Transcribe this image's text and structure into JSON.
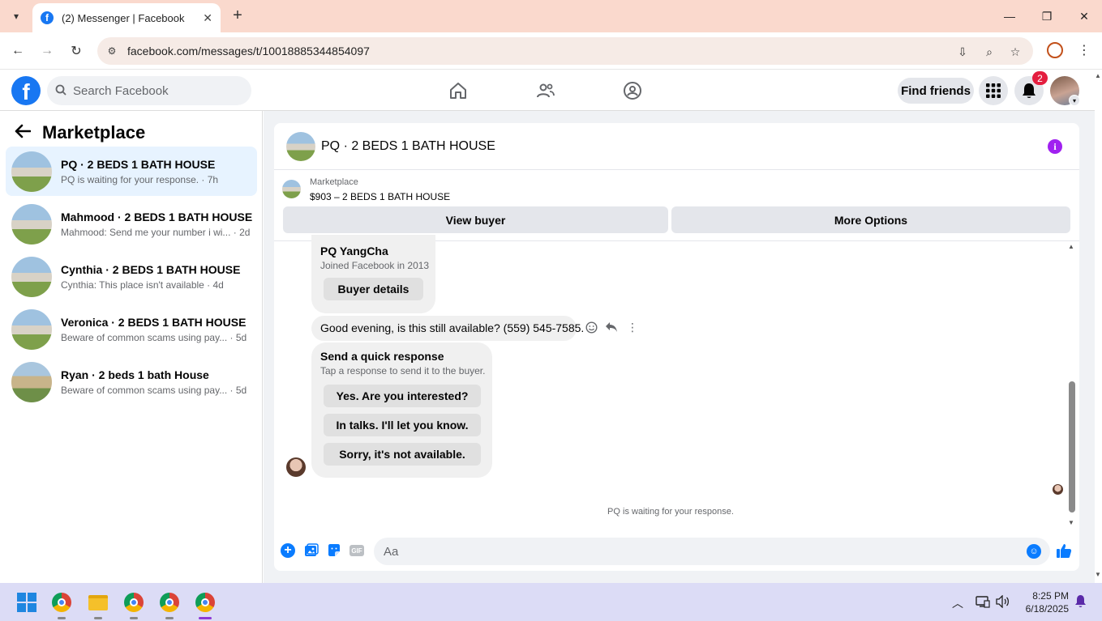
{
  "browser": {
    "tab_title": "(2) Messenger | Facebook",
    "url": "facebook.com/messages/t/10018885344854097"
  },
  "fb_header": {
    "logo": "f",
    "search_placeholder": "Search Facebook",
    "find_friends_label": "Find friends",
    "notification_count": "2"
  },
  "sidebar": {
    "title": "Marketplace",
    "conversations": [
      {
        "name": "PQ · 2 BEDS 1 BATH HOUSE",
        "preview": "PQ is waiting for your response. · 7h"
      },
      {
        "name": "Mahmood · 2 BEDS 1 BATH HOUSE",
        "preview": "Mahmood: Send me your number i wi... · 2d"
      },
      {
        "name": "Cynthia · 2 BEDS 1 BATH HOUSE",
        "preview": "Cynthia: This place isn't available · 4d"
      },
      {
        "name": "Veronica · 2 BEDS 1 BATH HOUSE",
        "preview": "Beware of common scams using pay... · 5d"
      },
      {
        "name": "Ryan · 2 beds 1 bath House",
        "preview": "Beware of common scams using pay... · 5d"
      }
    ]
  },
  "conversation": {
    "title": "PQ · 2 BEDS 1 BATH HOUSE",
    "listing_source": "Marketplace",
    "listing_price": "$903 – 2 BEDS 1 BATH HOUSE",
    "view_buyer_label": "View buyer",
    "more_options_label": "More Options",
    "buyer_card": {
      "name": "PQ YangCha",
      "joined": "Joined Facebook in 2013",
      "button": "Buyer details"
    },
    "message": "Good evening, is this still available? (559) 545-7585.",
    "quick_response": {
      "title": "Send a quick response",
      "subtitle": "Tap a response to send it to the buyer.",
      "options": [
        "Yes. Are you interested?",
        "In talks. I'll let you know.",
        "Sorry, it's not available."
      ]
    },
    "waiting_text": "PQ is waiting for your response.",
    "composer_placeholder": "Aa",
    "gif_label": "GIF"
  },
  "taskbar": {
    "time": "8:25 PM",
    "date": "6/18/2025"
  },
  "colors": {
    "brand": "#1877f2",
    "messenger_blue": "#0a7cff",
    "info_purple": "#a020f0",
    "badge_red": "#e41e3f",
    "tabbar_bg": "#fad9cd"
  }
}
